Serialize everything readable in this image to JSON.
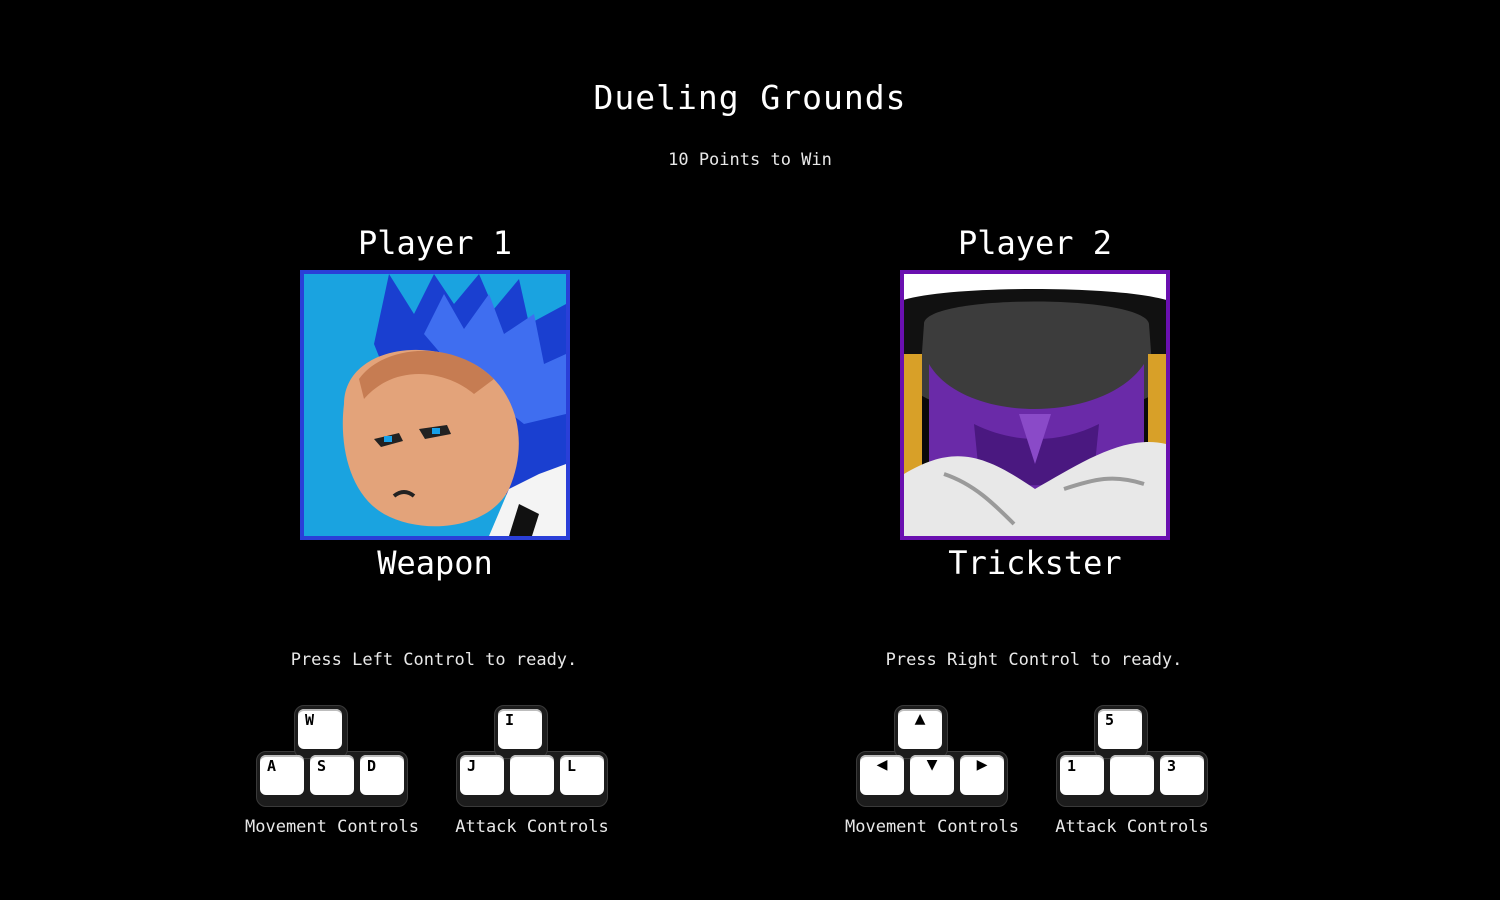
{
  "header": {
    "title": "Dueling Grounds",
    "subtitle": "10 Points to Win"
  },
  "players": [
    {
      "label": "Player 1",
      "character": "Weapon",
      "portrait_border_color": "#2a3fd8",
      "ready_text": "Press Left Control to ready.",
      "movement": {
        "label": "Movement Controls",
        "keys": [
          "W",
          "A",
          "S",
          "D"
        ]
      },
      "attack": {
        "label": "Attack Controls",
        "keys": [
          "I",
          "J",
          "",
          "L"
        ]
      }
    },
    {
      "label": "Player 2",
      "character": "Trickster",
      "portrait_border_color": "#6a10b0",
      "ready_text": "Press Right Control to ready.",
      "movement": {
        "label": "Movement Controls",
        "keys": [
          "▲",
          "◀",
          "▼",
          "▶"
        ]
      },
      "attack": {
        "label": "Attack Controls",
        "keys": [
          "5",
          "1",
          "",
          "3"
        ]
      }
    }
  ]
}
